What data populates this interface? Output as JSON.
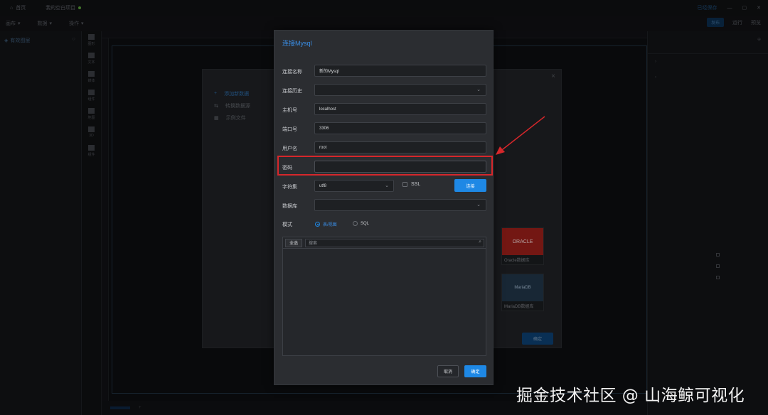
{
  "titlebar": {
    "home": "首页",
    "project": "我的空白项目",
    "right_badge": "已经保存"
  },
  "menubar": {
    "items": [
      "画布",
      "数据",
      "操作"
    ],
    "publish": "发布",
    "run": "运行",
    "preview": "预览"
  },
  "leftpanel": {
    "title": "有效图层"
  },
  "iconbar": {
    "items": [
      "图形",
      "文本",
      "媒体",
      "组件",
      "地图",
      "3D",
      "组件"
    ]
  },
  "back_dialog": {
    "menu": [
      "添加新数据",
      "转换数据源",
      "示例文件"
    ],
    "cards": [
      "Oracle数据库",
      "MariaDB数据库"
    ],
    "ok": "确定"
  },
  "dialog": {
    "title": "连接Mysql",
    "fields": {
      "conn_name_label": "连接名称",
      "conn_name_value": "新的Mysql",
      "history_label": "连接历史",
      "host_label": "主机号",
      "host_value": "localhost",
      "port_label": "端口号",
      "port_value": "3306",
      "user_label": "用户名",
      "user_value": "root",
      "password_label": "密码",
      "password_value": "",
      "charset_label": "字符集",
      "charset_value": "utf8",
      "ssl_label": "SSL",
      "connect_button": "连接",
      "database_label": "数据库"
    },
    "mode": {
      "label": "模式",
      "option1": "表/视图",
      "option2": "SQL",
      "selected": "表/视图"
    },
    "table_all": "全选",
    "search_placeholder": "搜索",
    "cancel": "取消",
    "ok": "确定"
  },
  "watermark": "掘金技术社区 @ 山海鲸可视化",
  "colors": {
    "accent": "#1e88e5",
    "highlight": "#d6272b",
    "dialog_bg": "#2b2d31"
  }
}
